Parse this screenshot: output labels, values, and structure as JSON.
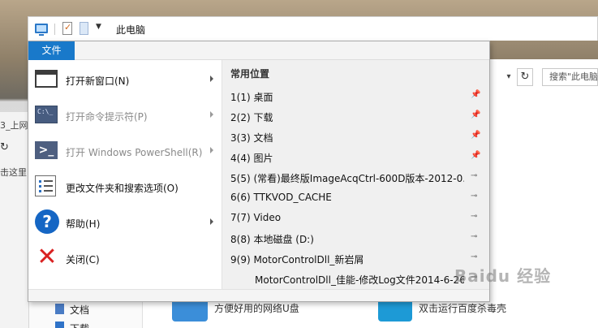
{
  "window": {
    "title": "此电脑"
  },
  "file_tab": {
    "label": "文件"
  },
  "file_menu": {
    "commands": [
      {
        "label": "打开新窗口(N)",
        "icon": "new-window-icon",
        "submenu": true,
        "enabled": true
      },
      {
        "label": "打开命令提示符(P)",
        "icon": "command-prompt-icon",
        "submenu": true,
        "enabled": false
      },
      {
        "label": "打开 Windows PowerShell(R)",
        "icon": "powershell-icon",
        "submenu": true,
        "enabled": false
      },
      {
        "label": "更改文件夹和搜索选项(O)",
        "icon": "folder-options-icon",
        "submenu": false,
        "enabled": true
      },
      {
        "label": "帮助(H)",
        "icon": "help-icon",
        "submenu": true,
        "enabled": true
      },
      {
        "label": "关闭(C)",
        "icon": "close-icon",
        "submenu": false,
        "enabled": true
      }
    ],
    "frequent_places": {
      "title": "常用位置",
      "items": [
        {
          "label": "1(1)  桌面",
          "pinned": true
        },
        {
          "label": "2(2)  下载",
          "pinned": true
        },
        {
          "label": "3(3)  文档",
          "pinned": true
        },
        {
          "label": "4(4)  图片",
          "pinned": true
        },
        {
          "label": "5(5)  (常看)最终版ImageAcqCtrl-600D版本-2012-0...",
          "pinned": false
        },
        {
          "label": "6(6)  TTKVOD_CACHE",
          "pinned": false
        },
        {
          "label": "7(7)  Video",
          "pinned": false
        },
        {
          "label": "8(8)  本地磁盘 (D:)",
          "pinned": false
        },
        {
          "label": "9(9)  MotorControlDll_新岩屑",
          "pinned": false
        },
        {
          "label": "MotorControlDll_佳能-修改Log文件2014-6-26...",
          "pinned": false
        }
      ]
    }
  },
  "background": {
    "search_placeholder": "搜索\"此电脑",
    "left_text_1": "3_上网",
    "left_text_2": "击这里",
    "nav_item_docs": "文档",
    "nav_item_downloads": "下载",
    "tile_1_text": "方便好用的网络U盘",
    "tile_2_text": "双击运行百度杀毒壳"
  },
  "colors": {
    "file_tab_bg": "#1979ca",
    "help_icon": "#1566c4",
    "close_icon": "#d92121"
  },
  "watermark": "Baidu 经验"
}
